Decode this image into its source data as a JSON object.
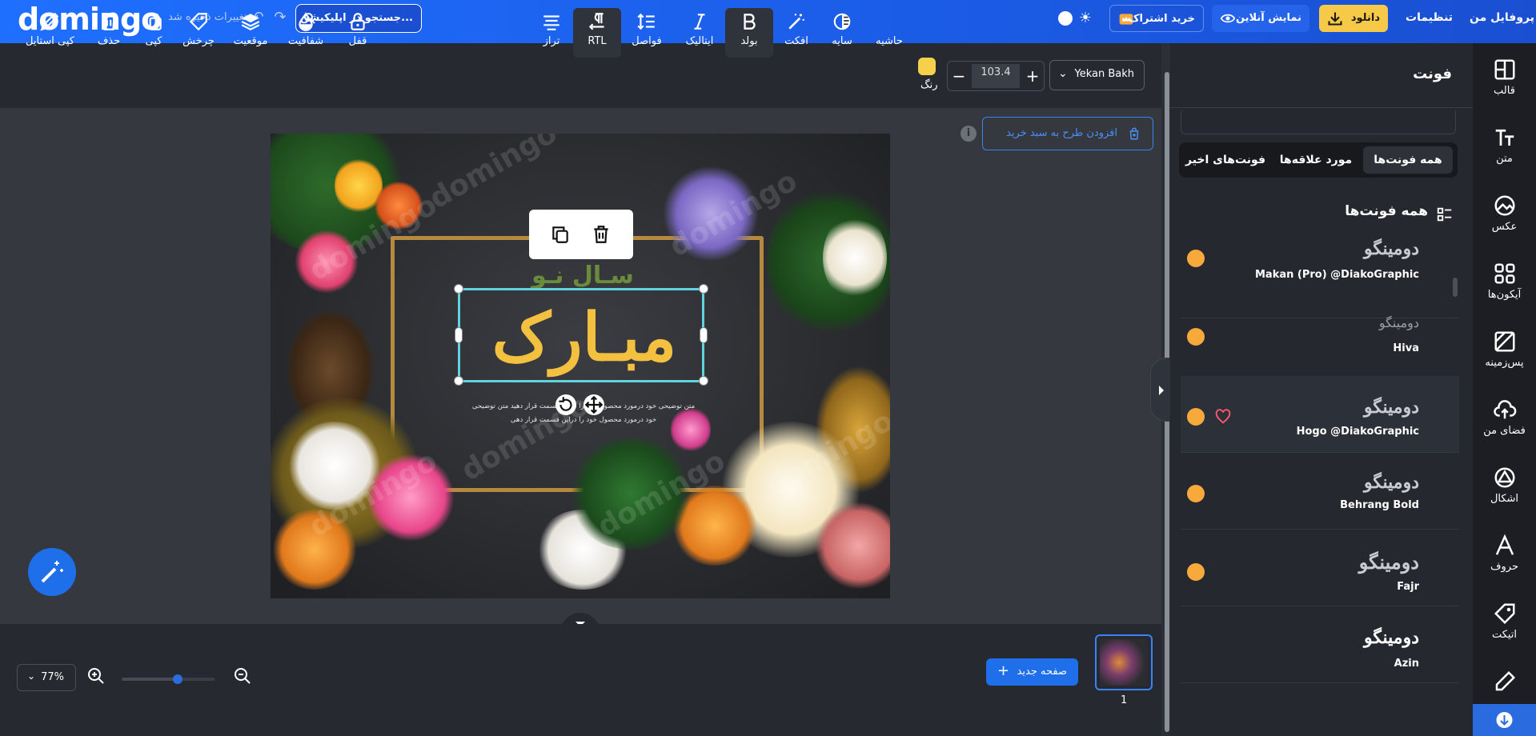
{
  "header": {
    "logo": "domingo",
    "saved_status": "تغییرات ذخیره شد",
    "search_placeholder": "جستجو در اپلیکیشن...",
    "subscribe_label": "خرید اشتراک",
    "online_view_label": "نمایش آنلاین",
    "download_label": "دانلود",
    "settings_label": "تنظیمات",
    "profile_label": "پروفایل من"
  },
  "toolbar": {
    "tools": [
      {
        "label": "کپی استایل",
        "icon": "brush-icon"
      },
      {
        "label": "حذف",
        "icon": "trash-icon"
      },
      {
        "label": "کپی",
        "icon": "copy-icon"
      },
      {
        "label": "چرخش",
        "icon": "tag-icon"
      },
      {
        "label": "موقعیت",
        "icon": "layers-icon"
      },
      {
        "label": "شفافیت",
        "icon": "drop-icon"
      },
      {
        "label": "قفل",
        "icon": "lock-icon"
      },
      {
        "label": "تراز",
        "icon": "align-icon"
      },
      {
        "label": "RTL",
        "icon": "rtl-icon"
      },
      {
        "label": "فواصل",
        "icon": "spacing-icon"
      },
      {
        "label": "ایتالیک",
        "icon": "italic-icon"
      },
      {
        "label": "بولد",
        "icon": "bold-icon"
      },
      {
        "label": "افکت",
        "icon": "magic-icon"
      },
      {
        "label": "سایه",
        "icon": "shadow-icon"
      },
      {
        "label": "حاشیه",
        "icon": "border-icon"
      }
    ],
    "color_label": "رنگ",
    "color_value": "#f7d04b",
    "font_size": "103.4",
    "font_family": "Yekan Bakh"
  },
  "canvas": {
    "add_to_cart": "افزودن طرح به سبد خرید",
    "design": {
      "subtitle": "سـال نـو",
      "title": "مبـارک",
      "description_line1": "متن توضیحی خود درمورد محصول خود را دراین قسمت قرار دهید متن توضیحی",
      "description_line2": "خود درمورد محصول خود را دراین قسمت قرار دهی",
      "watermark": "domingo"
    }
  },
  "bottom": {
    "zoom": "77%",
    "zoom_level": 0.77,
    "new_page": "صفحه جدید",
    "page_number": "1"
  },
  "font_panel": {
    "title": "فونت",
    "tabs": [
      "همه فونت‌ها",
      "مورد علاقه‌ها",
      "فونت‌های اخیر"
    ],
    "active_tab": 0,
    "section_title": "همه فونت‌ها",
    "fonts": [
      {
        "preview": "دومینگو",
        "name": "Makan (Pro) @DiakoGraphic"
      },
      {
        "preview": "دومینگو",
        "name": "Hiva"
      },
      {
        "preview": "دومینگو",
        "name": "Hogo @DiakoGraphic"
      },
      {
        "preview": "دومینگو",
        "name": "Behrang Bold"
      },
      {
        "preview": "دومینگو",
        "name": "Fajr"
      },
      {
        "preview": "دومینگو",
        "name": "Azin"
      }
    ]
  },
  "sidebar": {
    "items": [
      {
        "label": "قالب",
        "icon": "template-icon"
      },
      {
        "label": "متن",
        "icon": "text-icon"
      },
      {
        "label": "عکس",
        "icon": "photo-icon"
      },
      {
        "label": "آیکون‌ها",
        "icon": "icons-grid-icon"
      },
      {
        "label": "پس‌زمینه",
        "icon": "background-icon"
      },
      {
        "label": "فضای من",
        "icon": "cloud-upload-icon"
      },
      {
        "label": "اشکال",
        "icon": "shapes-icon"
      },
      {
        "label": "حروف",
        "icon": "letters-icon"
      },
      {
        "label": "اتیکت",
        "icon": "sticker-icon"
      },
      {
        "label": "",
        "icon": "pen-icon"
      }
    ]
  }
}
